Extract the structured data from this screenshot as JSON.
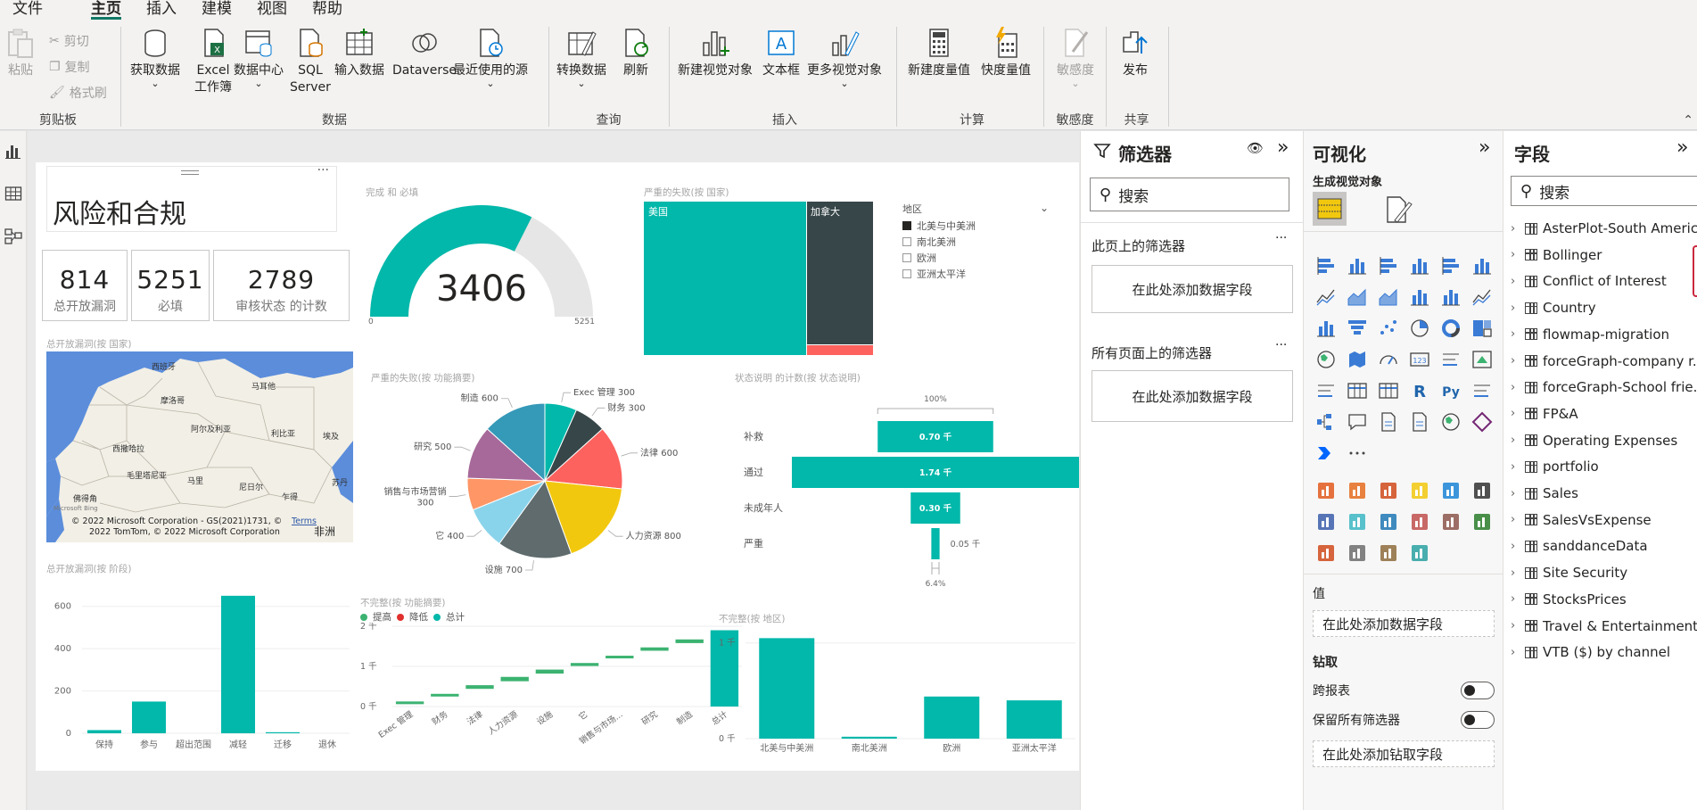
{
  "menu": [
    "文件",
    "主页",
    "插入",
    "建模",
    "视图",
    "帮助"
  ],
  "ribbon": {
    "clipboard": {
      "paste": "粘贴",
      "cut": "剪切",
      "copy": "复制",
      "format_painter": "格式刷",
      "label": "剪贴板"
    },
    "data": {
      "get_data": "获取数据",
      "excel_1": "Excel",
      "excel_2": "工作簿",
      "datahub": "数据中心",
      "sql_1": "SQL",
      "sql_2": "Server",
      "enter_data": "输入数据",
      "dataverse": "Dataverse",
      "recent": "最近使用的源",
      "label": "数据"
    },
    "query": {
      "transform": "转换数据",
      "refresh": "刷新",
      "label": "查询"
    },
    "insert": {
      "new_visual": "新建视觉对象",
      "textbox": "文本框",
      "more_visuals": "更多视觉对象",
      "label": "插入"
    },
    "calc": {
      "new_measure": "新建度量值",
      "quick_measure": "快度量值",
      "label": "计算"
    },
    "sensitivity": {
      "btn": "敏感度",
      "label": "敏感度"
    },
    "share": {
      "publish": "发布",
      "label": "共享"
    }
  },
  "report": {
    "title": "风险和合规",
    "cards": [
      {
        "value": "814",
        "label": "总开放漏洞"
      },
      {
        "value": "5251",
        "label": "必填"
      },
      {
        "value": "2789",
        "label": "审核状态 的计数"
      }
    ],
    "gauge": {
      "title": "完成 和 必填",
      "value": "3406",
      "min": "0",
      "max": "5251",
      "ratio": 0.6487
    },
    "map": {
      "title": "总开放漏洞(按 国家)",
      "labels": [
        "西班牙",
        "马耳他",
        "摩洛哥",
        "阿尔及利亚",
        "利比亚",
        "埃及",
        "西撒哈拉",
        "毛里塔尼亚",
        "马里",
        "尼日尔",
        "乍得",
        "苏丹",
        "佛得角"
      ],
      "copyright_1": "© 2022 Microsoft Corporation - GS(2021)1731, ©",
      "terms": "Terms",
      "copyright_2": "2022 TomTom, © 2022 Microsoft Corporation",
      "africa": "非洲",
      "brand": "Microsoft Bing"
    },
    "treemap": {
      "title": "严重的失败(按 国家)",
      "us": "美国",
      "canada": "加拿大",
      "legend_title": "地区",
      "legend": [
        "北美与中美洲",
        "南北美洲",
        "欧洲",
        "亚洲太平洋"
      ]
    },
    "pie": {
      "title": "严重的失败(按 功能摘要)",
      "slices": [
        {
          "label": "Exec 管理 300",
          "value": 300,
          "color": "#01B8AA"
        },
        {
          "label": "财务 300",
          "value": 300,
          "color": "#374649"
        },
        {
          "label": "法律 600",
          "value": 600,
          "color": "#FD625E"
        },
        {
          "label": "人力资源 800",
          "value": 800,
          "color": "#F2C80F"
        },
        {
          "label": "设施 700",
          "value": 700,
          "color": "#5F6B6D"
        },
        {
          "label": "它 400",
          "value": 400,
          "color": "#8AD4EB"
        },
        {
          "label_1": "销售与市场营销",
          "label_2": "300",
          "value": 300,
          "color": "#FE9666"
        },
        {
          "label": "研究 500",
          "value": 500,
          "color": "#A66999"
        },
        {
          "label": "制造 600",
          "value": 600,
          "color": "#3599B8"
        }
      ]
    },
    "funnel": {
      "title": "状态说明 的计数(按 状态说明)",
      "top_pct": "100%",
      "bottom_pct": "6.4%",
      "rows": [
        {
          "cat": "补救",
          "value": 0.7,
          "label": "0.70 千"
        },
        {
          "cat": "通过",
          "value": 1.74,
          "label": "1.74 千"
        },
        {
          "cat": "未成年人",
          "value": 0.3,
          "label": "0.30 千"
        },
        {
          "cat": "严重",
          "value": 0.05,
          "label": "0.05 千"
        }
      ]
    },
    "bar_stage": {
      "title": "总开放漏洞(按 阶段)",
      "categories": [
        "保持",
        "参与",
        "超出范围",
        "减轻",
        "迁移",
        "退休"
      ],
      "values": [
        15,
        150,
        0,
        650,
        5,
        0
      ],
      "yticks": [
        "0",
        "200",
        "400",
        "600"
      ],
      "ymax": 700
    },
    "waterfall": {
      "title": "不完整(按 功能摘要)",
      "legend": [
        "提高",
        "降低",
        "总计"
      ],
      "yticks": [
        "0 千",
        "1 千",
        "2 千"
      ],
      "categories": [
        "Exec 管理",
        "财务",
        "法律",
        "人力资源",
        "设施",
        "它",
        "销售与市场...",
        "研究",
        "制造",
        "总计"
      ]
    },
    "bar_region": {
      "title": "不完整(按 地区)",
      "categories": [
        "北美与中美洲",
        "南北美洲",
        "欧洲",
        "亚洲太平洋"
      ],
      "values": [
        1.05,
        0.02,
        0.44,
        0.4
      ],
      "yticks": [
        "0 千",
        "1 千"
      ],
      "ymax": 1.1
    }
  },
  "filters": {
    "title": "筛选器",
    "search": "搜索",
    "this_page": "此页上的筛选器",
    "all_pages": "所有页面上的筛选器",
    "add_field": "在此处添加数据字段"
  },
  "viz": {
    "title": "可视化",
    "build": "生成视觉对象",
    "values": "值",
    "add_field": "在此处添加数据字段",
    "drill": "钻取",
    "cross_report": "跨报表",
    "keep_filters": "保留所有筛选器",
    "add_drill": "在此处添加钻取字段"
  },
  "fields": {
    "title": "字段",
    "search": "搜索",
    "items": [
      "AsterPlot-South America",
      "Bollinger",
      "Conflict of Interest",
      "Country",
      "flowmap-migration",
      "forceGraph-company r...",
      "forceGraph-School frie...",
      "FP&A",
      "Operating Expenses",
      "portfolio",
      "Sales",
      "SalesVsExpense",
      "sanddanceData",
      "Site Security",
      "StocksPrices",
      "Travel & Entertainment",
      "VTB ($) by channel"
    ]
  },
  "colors": {
    "teal": "#01B8AA",
    "dark": "#374649",
    "red": "#FD625E",
    "accent": "#117865"
  }
}
